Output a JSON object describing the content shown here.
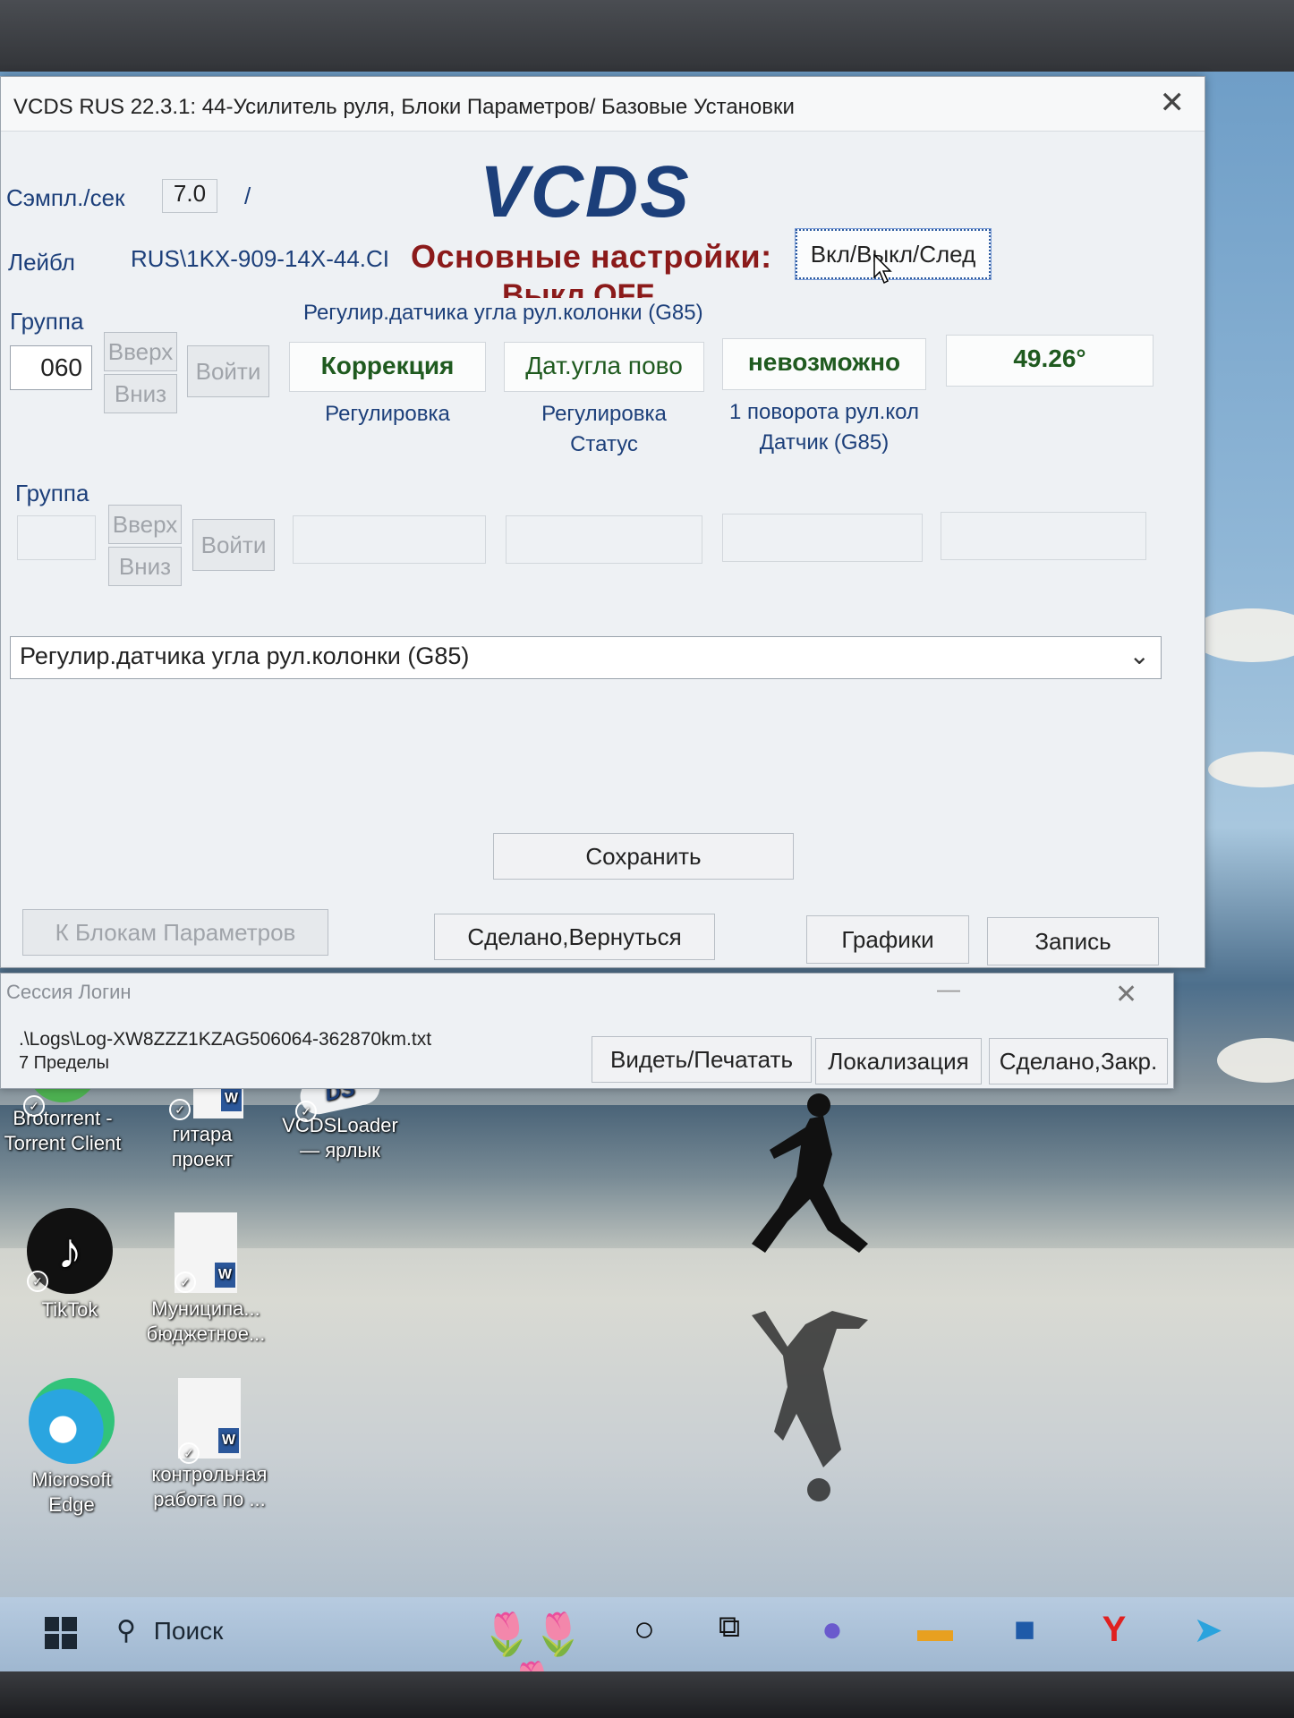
{
  "main_window": {
    "title": "VCDS RUS 22.3.1: 44-Усилитель руля,  Блоки Параметров/ Базовые Установки",
    "close": "✕",
    "samples_label": "Сэмпл./сек",
    "samples_value": "7.0",
    "samples_sep": "/",
    "logo": "VCDS",
    "label_label": "Лейбл",
    "label_value": "RUS\\1KX-909-14X-44.CI",
    "heading": "Основные настройки:",
    "heading_sub": "Выкл OFF",
    "toggle_button": "Вкл/Выкл/След",
    "group1": {
      "label": "Группа",
      "value": "060",
      "up": "Вверх",
      "down": "Вниз",
      "enter": "Войти",
      "title": "Регулир.датчика угла рул.колонки (G85)",
      "fields": [
        {
          "value": "Коррекция",
          "label": "Регулировка"
        },
        {
          "value": "Дат.угла пово",
          "label": "Регулировка\nСтатус"
        },
        {
          "value": "невозможно",
          "label": "1 поворота рул.кол\nДатчик (G85)"
        },
        {
          "value": "49.26°",
          "label": ""
        }
      ]
    },
    "group2": {
      "label": "Группа",
      "value": "",
      "up": "Вверх",
      "down": "Вниз",
      "enter": "Войти"
    },
    "combo_value": "Регулир.датчика угла рул.колонки (G85)",
    "save": "Сохранить",
    "back_to_blocks": "К Блокам Параметров",
    "done_return": "Сделано,Вернуться",
    "graphs": "Графики",
    "record": "Запись"
  },
  "session_window": {
    "title": "Сессия Логин",
    "minimize": "—",
    "close": "✕",
    "path": ".\\Logs\\Log-XW8ZZZ1KZAG506064-362870km.txt",
    "count": "7 Пределы",
    "view_print": "Видеть/Печатать",
    "localization": "Локализация",
    "done_close": "Сделано,Закр."
  },
  "desktop_icons": [
    {
      "label": "Brotorrent -\nTorrent Client",
      "icon": "torrent-icon"
    },
    {
      "label": "гитара\nпроект",
      "icon": "word-doc-icon"
    },
    {
      "label": "VCDSLoader\n— ярлык",
      "icon": "vcds-icon"
    },
    {
      "label": "TikTok",
      "icon": "tiktok-icon"
    },
    {
      "label": "Муниципа...\nбюджетное...",
      "icon": "word-doc-icon"
    },
    {
      "label": "Microsoft\nEdge",
      "icon": "edge-icon"
    },
    {
      "label": "контрольная\nработа по ...",
      "icon": "word-doc-icon"
    }
  ],
  "taskbar": {
    "search": "Поиск"
  },
  "colors": {
    "vcds_blue": "#1c3f7a",
    "heading_red": "#8b1a1a",
    "value_green": "#1f5a1f"
  }
}
